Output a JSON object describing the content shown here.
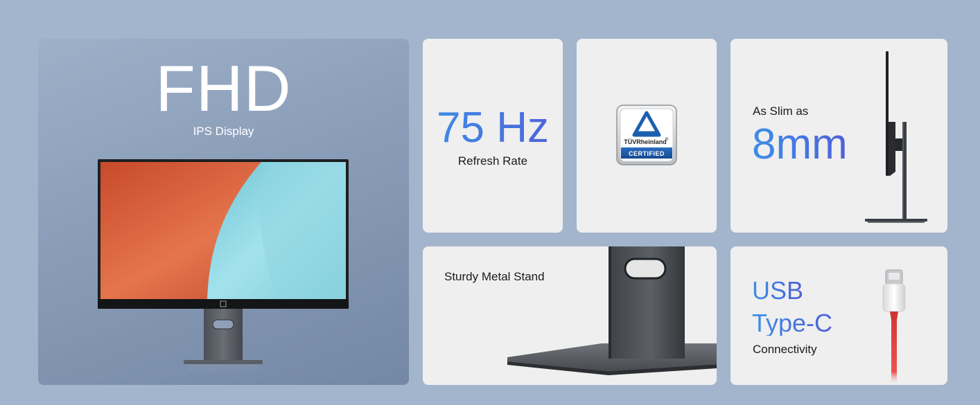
{
  "hero": {
    "title": "FHD",
    "subtitle": "IPS Display",
    "image_icon": "monitor-front-image"
  },
  "refresh": {
    "value": "75 Hz",
    "label": "Refresh Rate"
  },
  "certification": {
    "badge_brand": "TÜVRheinland",
    "badge_registered": "®",
    "badge_label": "CERTIFIED"
  },
  "slim": {
    "label": "As Slim as",
    "value": "8mm",
    "image_icon": "monitor-side-profile-image"
  },
  "stand": {
    "label": "Sturdy Metal Stand",
    "image_icon": "metal-stand-image"
  },
  "usb": {
    "line1": "USB",
    "line2": "Type-C",
    "label": "Connectivity",
    "image_icon": "usb-c-cable-image"
  },
  "colors": {
    "page_bg": "#a3b5cc",
    "card_bg": "#efefef",
    "gradient_start": "#3b8fe8",
    "gradient_end": "#5060d8"
  }
}
